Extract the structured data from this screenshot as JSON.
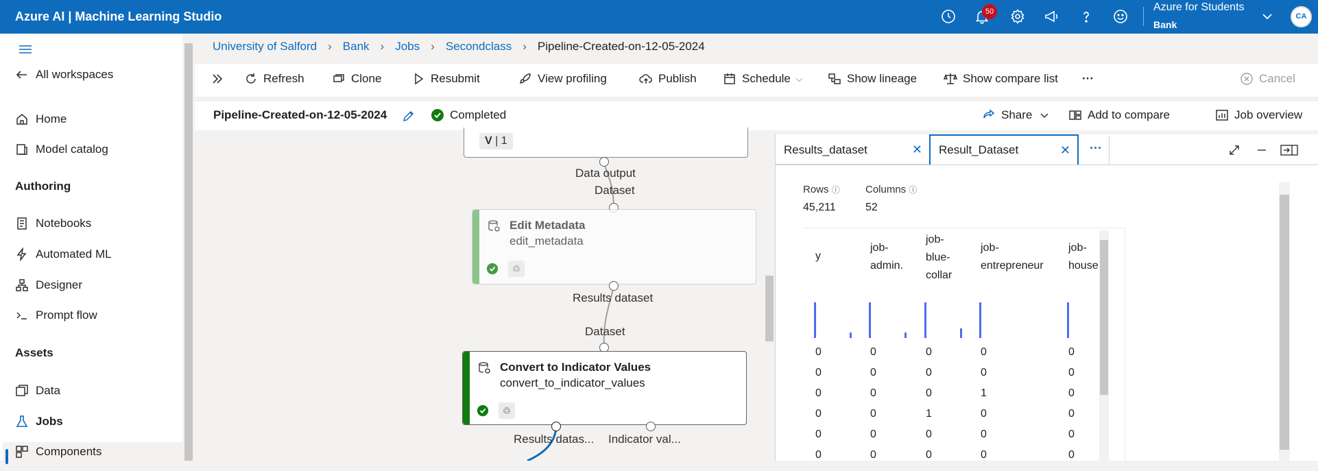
{
  "app": {
    "title": "Azure AI | Machine Learning Studio",
    "notifications": "50",
    "account_name": "Azure for Students",
    "account_sub": "Bank",
    "initials": "CA"
  },
  "sidebar": {
    "all_workspaces": "All workspaces",
    "home": "Home",
    "model_catalog": "Model catalog",
    "authoring": "Authoring",
    "notebooks": "Notebooks",
    "automated_ml": "Automated ML",
    "designer": "Designer",
    "prompt_flow": "Prompt flow",
    "assets": "Assets",
    "data": "Data",
    "jobs": "Jobs",
    "components": "Components"
  },
  "breadcrumb": [
    "University of Salford",
    "Bank",
    "Jobs",
    "Secondclass",
    "Pipeline-Created-on-12-05-2024"
  ],
  "toolbar": {
    "refresh": "Refresh",
    "clone": "Clone",
    "resubmit": "Resubmit",
    "view_profiling": "View profiling",
    "publish": "Publish",
    "schedule": "Schedule",
    "show_lineage": "Show lineage",
    "show_compare_list": "Show compare list",
    "more": "···",
    "cancel": "Cancel"
  },
  "job": {
    "name": "Pipeline-Created-on-12-05-2024",
    "status": "Completed",
    "share": "Share",
    "add_to_compare": "Add to compare",
    "job_overview": "Job overview"
  },
  "canvas": {
    "version_v": "V",
    "version_n": "1",
    "top_out": "Data output",
    "top_in": "Dataset",
    "node1_title": "Edit Metadata",
    "node1_sub": "edit_metadata",
    "node1_out": "Results dataset",
    "node2_in": "Dataset",
    "node2_title": "Convert to Indicator Values",
    "node2_sub": "convert_to_indicator_values",
    "node2_out1": "Results datas...",
    "node2_out2": "Indicator val..."
  },
  "panel": {
    "tab1": "Results_dataset",
    "tab2": "Result_Dataset",
    "more": "···",
    "rows_label": "Rows",
    "rows_value": "45,211",
    "cols_label": "Columns",
    "cols_value": "52",
    "columns": [
      "y",
      "job-\nadmin.",
      "job-\nblue-\ncollar",
      "job-\nentrepreneur",
      "job-\nhouse"
    ],
    "rows": [
      [
        "0",
        "0",
        "0",
        "0",
        "0"
      ],
      [
        "0",
        "0",
        "0",
        "0",
        "0"
      ],
      [
        "0",
        "0",
        "0",
        "1",
        "0"
      ],
      [
        "0",
        "0",
        "1",
        "0",
        "0"
      ],
      [
        "0",
        "0",
        "0",
        "0",
        "0"
      ],
      [
        "0",
        "0",
        "0",
        "0",
        "0"
      ]
    ]
  },
  "colors": {
    "accent": "#0f6cbd",
    "success": "#107c10",
    "bar": "#4f6bed",
    "badge": "#c50f1f"
  }
}
